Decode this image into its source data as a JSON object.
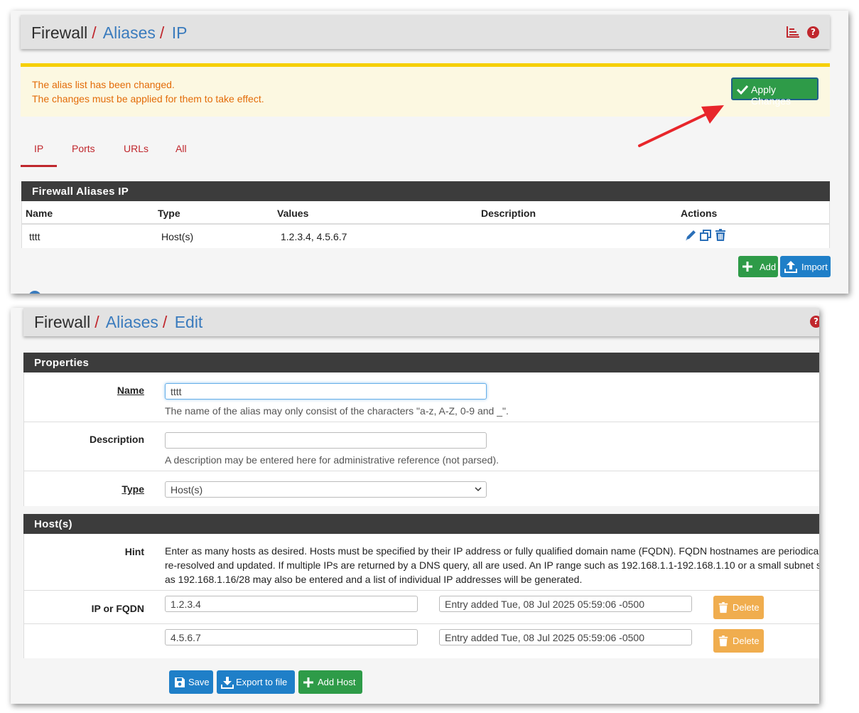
{
  "aliases_page": {
    "breadcrumb": {
      "root": "Firewall",
      "level1": "Aliases",
      "level2": "IP"
    },
    "alert": {
      "line1": "The alias list has been changed.",
      "line2": "The changes must be applied for them to take effect.",
      "apply_label": "Apply Changes"
    },
    "tabs": [
      {
        "label": "IP",
        "active": true
      },
      {
        "label": "Ports"
      },
      {
        "label": "URLs"
      },
      {
        "label": "All"
      }
    ],
    "table": {
      "title": "Firewall Aliases IP",
      "headers": {
        "name": "Name",
        "type": "Type",
        "values": "Values",
        "description": "Description",
        "actions": "Actions"
      },
      "rows": [
        {
          "name": "tttt",
          "type": "Host(s)",
          "values": "1.2.3.4, 4.5.6.7",
          "description": ""
        }
      ]
    },
    "buttons": {
      "add": "Add",
      "import": "Import"
    }
  },
  "edit_page": {
    "breadcrumb": {
      "root": "Firewall",
      "level1": "Aliases",
      "level2": "Edit"
    },
    "properties": {
      "title": "Properties",
      "name_label": "Name",
      "name_value": "tttt",
      "name_help": "The name of the alias may only consist of the characters \"a-z, A-Z, 0-9 and _\".",
      "description_label": "Description",
      "description_value": "",
      "description_help": "A description may be entered here for administrative reference (not parsed).",
      "type_label": "Type",
      "type_value": "Host(s)"
    },
    "hosts": {
      "title": "Host(s)",
      "hint_label": "Hint",
      "hint_line1": "Enter as many hosts as desired. Hosts must be specified by their IP address or fully qualified domain name (FQDN). FQDN hostnames are periodically",
      "hint_line2": "re-resolved and updated. If multiple IPs are returned by a DNS query, all are used. An IP range such as 192.168.1.1-192.168.1.10 or a small subnet such",
      "hint_line3": "as 192.168.1.16/28 may also be entered and a list of individual IP addresses will be generated.",
      "ip_label": "IP or FQDN",
      "entries": [
        {
          "address": "1.2.3.4",
          "note": "Entry added Tue, 08 Jul 2025 05:59:06 -0500",
          "delete_label": "Delete"
        },
        {
          "address": "4.5.6.7",
          "note": "Entry added Tue, 08 Jul 2025 05:59:06 -0500",
          "delete_label": "Delete"
        }
      ]
    },
    "buttons": {
      "save": "Save",
      "export": "Export to file",
      "add_host": "Add Host"
    }
  },
  "colors": {
    "accent_red": "#c0272d",
    "link_blue": "#3a7bbd",
    "success_green": "#2e9b48",
    "primary_blue": "#1f7fc8",
    "warning_orange": "#f0ad4e",
    "alert_text": "#e36c09"
  }
}
